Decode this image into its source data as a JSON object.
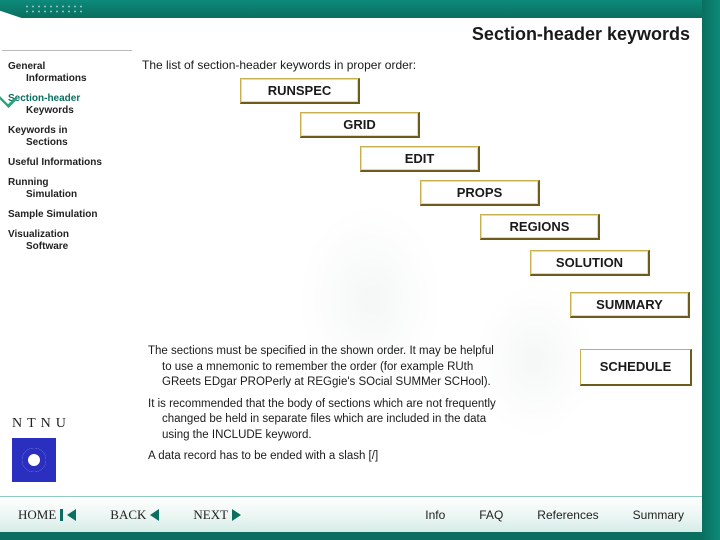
{
  "header": {
    "title": "Section-header keywords"
  },
  "sidebar": {
    "items": [
      {
        "line1": "General",
        "line2": "Informations",
        "current": false
      },
      {
        "line1": "Section-header",
        "line2": "Keywords",
        "current": true
      },
      {
        "line1": "Keywords in",
        "line2": "Sections",
        "current": false
      },
      {
        "line1": "Useful Informations",
        "line2": "",
        "current": false
      },
      {
        "line1": "Running",
        "line2": "Simulation",
        "current": false
      },
      {
        "line1": "Sample Simulation",
        "line2": "",
        "current": false
      },
      {
        "line1": "Visualization",
        "line2": "Software",
        "current": false
      }
    ]
  },
  "main": {
    "intro": "The list of section-header keywords in proper order:",
    "keywords": [
      "RUNSPEC",
      "GRID",
      "EDIT",
      "PROPS",
      "REGIONS",
      "SOLUTION",
      "SUMMARY",
      "SCHEDULE"
    ],
    "notes": [
      {
        "l1": "The sections must be specified in the shown order. It may be helpful",
        "l2": "to use a mnemonic to remember the order (for example RUth",
        "l3": "GReets EDgar PROPerly at REGgie's SOcial SUMMer SCHool)."
      },
      {
        "l1": "It is recommended that the body of sections which are not frequently",
        "l2": "changed be held in separate files which are included in the data",
        "l3": "using the INCLUDE keyword."
      },
      {
        "l1": "A data record has to be ended with a slash [/]"
      }
    ]
  },
  "brand": {
    "text": "NTNU"
  },
  "footer": {
    "nav": [
      "HOME",
      "BACK",
      "NEXT"
    ],
    "links": [
      "Info",
      "FAQ",
      "References",
      "Summary"
    ]
  },
  "colors": {
    "teal": "#0a6e60",
    "accent_border": "#c8b050",
    "logo_blue": "#2b2fbf"
  }
}
